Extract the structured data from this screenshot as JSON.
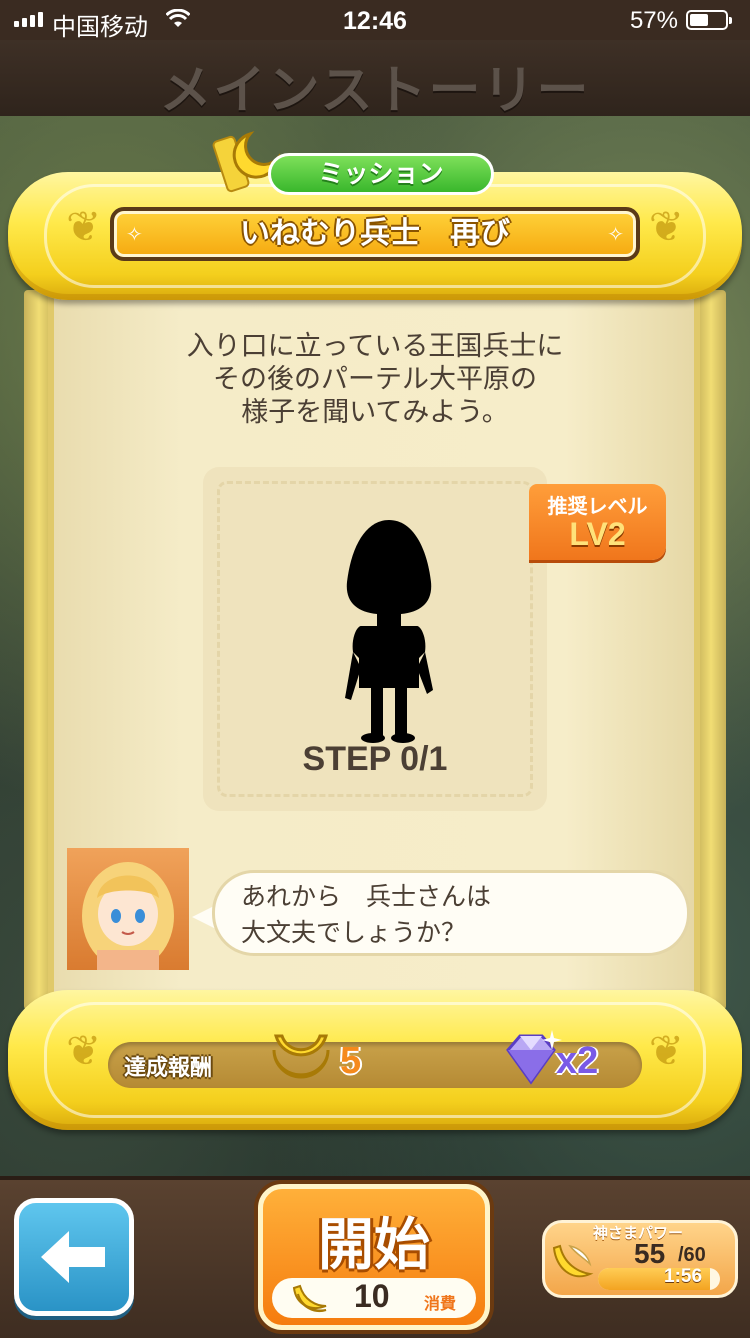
{
  "status_bar": {
    "carrier": "中国移动",
    "time": "12:46",
    "battery_percent": "57%",
    "battery_level": 0.57,
    "icons": [
      "signal-icon",
      "wifi-icon",
      "battery-icon"
    ]
  },
  "header": {
    "title": "メインストーリー"
  },
  "mission": {
    "tab_label": "ミッション",
    "title": "いねむり兵士　再び",
    "description": [
      "入り口に立っている王国兵士に",
      "その後のパーテル大平原の",
      "様子を聞いてみよう。"
    ],
    "step": "STEP  0/1",
    "recommended_level": {
      "label": "推奨レベル",
      "value": "LV2"
    }
  },
  "dialog": {
    "lines": [
      "あれから　兵士さんは",
      "大文夫でしょうか？"
    ]
  },
  "reward": {
    "label": "達成報酬",
    "moon_amount": "5",
    "gem_amount": "x2"
  },
  "footer": {
    "start_label": "開始",
    "cost_amount": "10",
    "cost_unit": "消費",
    "power": {
      "title": "神さまパワー",
      "current": "55",
      "max": "/60",
      "timer": "1:56",
      "fill_fraction": 0.917
    }
  },
  "colors": {
    "accent_green": "#39b72c",
    "scroll_gold": "#ffe94a",
    "button_orange": "#f57c0e",
    "back_blue": "#2a93c6",
    "level_orange": "#f0761c"
  }
}
